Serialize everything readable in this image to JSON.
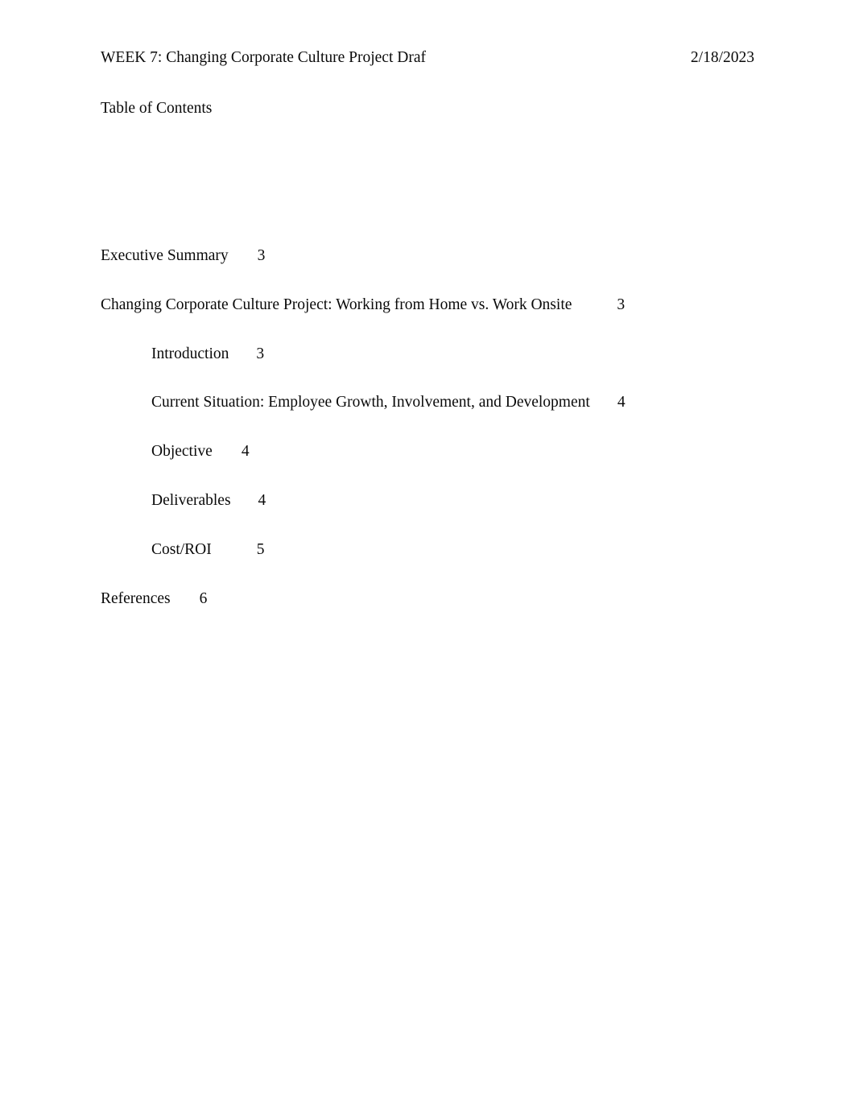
{
  "document": {
    "header": {
      "title": "WEEK 7: Changing Corporate Culture Project Draf",
      "date": "2/18/2023"
    },
    "toc_heading": "Table of Contents",
    "toc_entries": [
      {
        "label": "Executive Summary",
        "page": "3",
        "level": 1
      },
      {
        "label": "Changing Corporate Culture Project: Working from Home vs. Work Onsite",
        "page": "3",
        "level": 1
      },
      {
        "label": "Introduction",
        "page": "3",
        "level": 2
      },
      {
        "label": "Current Situation: Employee Growth, Involvement, and Development",
        "page": "4",
        "level": 2
      },
      {
        "label": "Objective",
        "page": "4",
        "level": 2
      },
      {
        "label": "Deliverables",
        "page": "4",
        "level": 2
      },
      {
        "label": "Cost/ROI",
        "page": "5",
        "level": 2
      },
      {
        "label": "References",
        "page": "6",
        "level": 1
      }
    ]
  },
  "colors": {
    "page_background": "#ffffff",
    "text": "#0a0a0a"
  }
}
